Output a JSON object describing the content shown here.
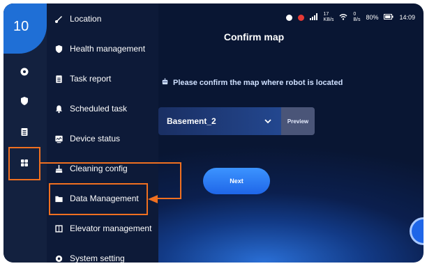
{
  "step_badge": "10",
  "status_bar": {
    "net_speed_up": "17",
    "net_speed_up_unit": "KB/s",
    "net_speed_down": "0",
    "net_speed_down_unit": "B/s",
    "battery": "80%",
    "time": "14:09"
  },
  "menu": {
    "items": [
      {
        "label": "Location",
        "icon": "location-icon"
      },
      {
        "label": "Health management",
        "icon": "shield-icon"
      },
      {
        "label": "Task report",
        "icon": "clipboard-icon"
      },
      {
        "label": "Scheduled task",
        "icon": "bell-icon"
      },
      {
        "label": "Device status",
        "icon": "monitor-icon"
      },
      {
        "label": "Cleaning config",
        "icon": "broom-icon"
      },
      {
        "label": "Data Management",
        "icon": "folder-icon"
      },
      {
        "label": "Elevator management",
        "icon": "elevator-icon"
      },
      {
        "label": "System setting",
        "icon": "gear-icon"
      }
    ]
  },
  "main": {
    "title": "Confirm map",
    "prompt": "Please confirm the map where robot is located",
    "selected_map": "Basement_2",
    "preview_label": "Preview",
    "next_label": "Next"
  },
  "colors": {
    "accent": "#1f66e8",
    "highlight": "#f07020",
    "menu_bg": "#0d1a38"
  }
}
